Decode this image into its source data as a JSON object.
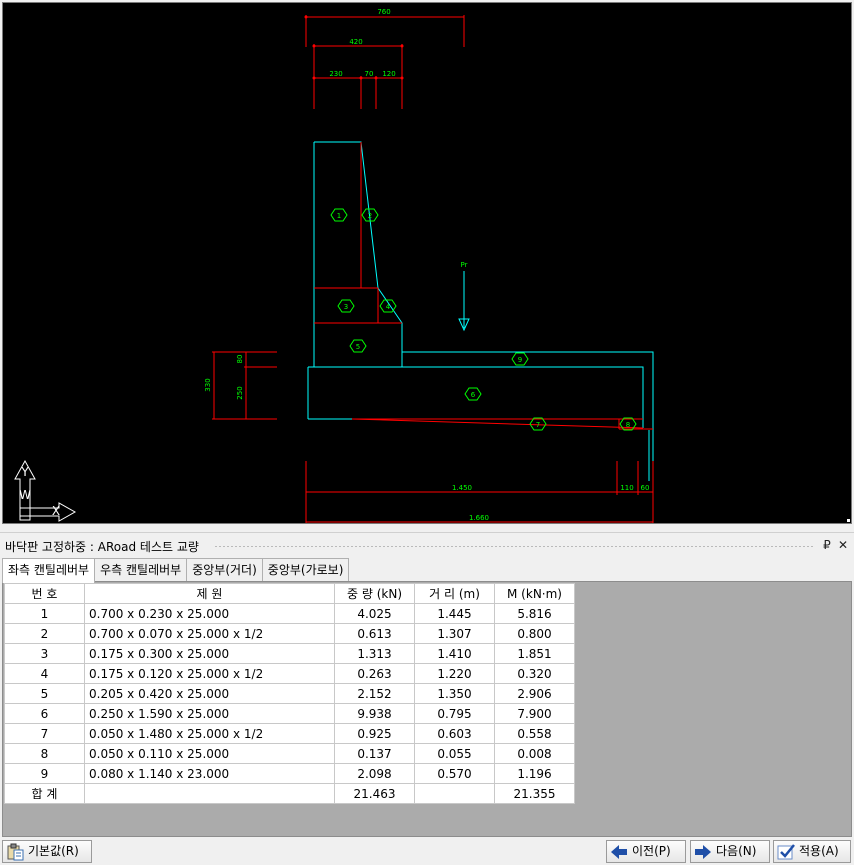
{
  "cad": {
    "dims_top": [
      "760",
      "420",
      "230",
      "70",
      "120"
    ],
    "dims_left": [
      "330",
      "80",
      "250"
    ],
    "dims_bottom": [
      "1.450",
      "110",
      "60",
      "1.660"
    ],
    "load_label": "Pr",
    "part_labels": [
      "1",
      "2",
      "3",
      "4",
      "5",
      "6",
      "7",
      "8",
      "9"
    ],
    "axis_y": "Y",
    "axis_w": "W",
    "axis_x": "X"
  },
  "panel": {
    "title": "바닥판 고정하중 : ARoad 테스트 교량",
    "pin": "₽",
    "close": "✕"
  },
  "tabs": [
    {
      "label": "좌측 캔틸레버부",
      "active": true
    },
    {
      "label": "우측 캔틸레버부",
      "active": false
    },
    {
      "label": "중앙부(거더)",
      "active": false
    },
    {
      "label": "중앙부(가로보)",
      "active": false
    }
  ],
  "table": {
    "headers": [
      "번 호",
      "제          원",
      "중 량 (kN)",
      "거 리 (m)",
      "M (kN·m)"
    ],
    "rows": [
      [
        "1",
        "0.700 x 0.230 x 25.000",
        "4.025",
        "1.445",
        "5.816"
      ],
      [
        "2",
        "0.700 x 0.070 x 25.000 x 1/2",
        "0.613",
        "1.307",
        "0.800"
      ],
      [
        "3",
        "0.175 x 0.300 x 25.000",
        "1.313",
        "1.410",
        "1.851"
      ],
      [
        "4",
        "0.175 x 0.120 x 25.000 x 1/2",
        "0.263",
        "1.220",
        "0.320"
      ],
      [
        "5",
        "0.205 x 0.420 x 25.000",
        "2.152",
        "1.350",
        "2.906"
      ],
      [
        "6",
        "0.250 x 1.590 x 25.000",
        "9.938",
        "0.795",
        "7.900"
      ],
      [
        "7",
        "0.050 x 1.480 x 25.000 x 1/2",
        "0.925",
        "0.603",
        "0.558"
      ],
      [
        "8",
        "0.050 x 0.110 x 25.000",
        "0.137",
        "0.055",
        "0.008"
      ],
      [
        "9",
        "0.080 x 1.140 x 23.000",
        "2.098",
        "0.570",
        "1.196"
      ]
    ],
    "total": [
      "합 계",
      "",
      "21.463",
      "",
      "21.355"
    ]
  },
  "buttons": {
    "default": "기본값(R)",
    "prev": "이전(P)",
    "next": "다음(N)",
    "apply": "적용(A)"
  },
  "colors": {
    "cad_bg": "#000000",
    "dim": "#ff0000",
    "dim_text": "#00ff00",
    "outline": "#00ffff",
    "label_circle": "#00ff00"
  }
}
